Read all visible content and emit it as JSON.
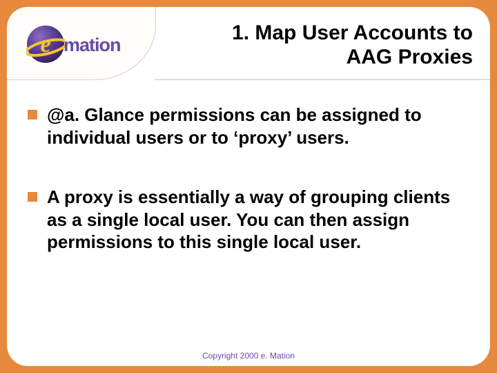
{
  "logo": {
    "word": "mation",
    "icon_name": "emation-logo-icon"
  },
  "title_line1": "1. Map User Accounts to",
  "title_line2": "AAG Proxies",
  "bullets": [
    "@a. Glance permissions can be assigned to individual users or to ‘proxy’ users.",
    "A proxy is essentially a way of grouping clients as a single local user.  You can then assign permissions to this single local user."
  ],
  "footer": "Copyright 2000 e. Mation",
  "colors": {
    "accent_orange": "#e6893c",
    "brand_purple": "#6a4aa6",
    "swoosh_yellow": "#f6c431"
  }
}
